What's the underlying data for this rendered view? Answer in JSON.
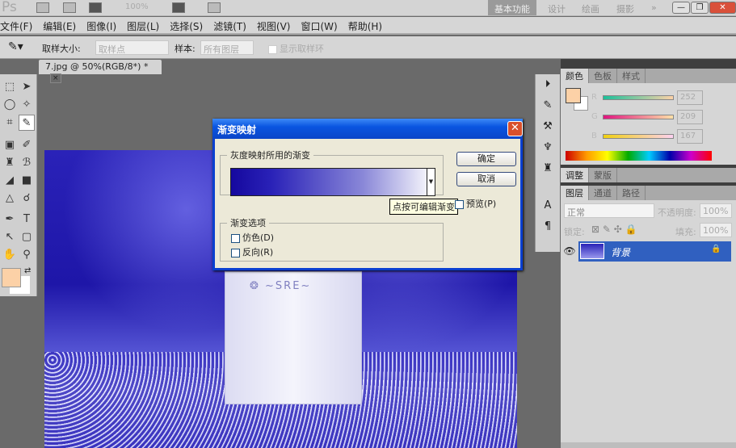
{
  "app": {
    "logo": "Ps",
    "zoom": "100%",
    "workspaces": [
      "基本功能",
      "设计",
      "绘画",
      "摄影"
    ],
    "more": "»"
  },
  "menu": [
    "文件(F)",
    "编辑(E)",
    "图像(I)",
    "图层(L)",
    "选择(S)",
    "滤镜(T)",
    "视图(V)",
    "窗口(W)",
    "帮助(H)"
  ],
  "options": {
    "sample_size_label": "取样大小:",
    "sample_size_value": "取样点",
    "sample_label": "样本:",
    "sample_value": "所有图层",
    "show_ring": "显示取样环"
  },
  "document": {
    "tab": "7.jpg @ 50%(RGB/8*) *",
    "close": "×"
  },
  "color_panel": {
    "tabs": [
      "颜色",
      "色板",
      "样式"
    ],
    "channels": [
      {
        "label": "R",
        "value": "252"
      },
      {
        "label": "G",
        "value": "209"
      },
      {
        "label": "B",
        "value": "167"
      }
    ],
    "foreground": "#fcd1a7",
    "background": "#ffffff"
  },
  "adjust_panel": {
    "tabs": [
      "调整",
      "蒙版"
    ]
  },
  "layers_panel": {
    "tabs": [
      "图层",
      "通道",
      "路径"
    ],
    "blend_mode": "正常",
    "opacity_label": "不透明度:",
    "opacity": "100%",
    "lock_label": "锁定:",
    "fill_label": "填充:",
    "fill": "100%",
    "layers": [
      {
        "name": "背景"
      }
    ]
  },
  "dialog": {
    "title": "渐变映射",
    "group1": "灰度映射所用的渐变",
    "gradient_start": "#15089e",
    "gradient_end": "#ffffff",
    "tooltip": "点按可编辑渐变",
    "ok": "确定",
    "cancel": "取消",
    "preview": "预览(P)",
    "group2": "渐变选项",
    "dither": "仿色(D)",
    "reverse": "反向(R)"
  }
}
